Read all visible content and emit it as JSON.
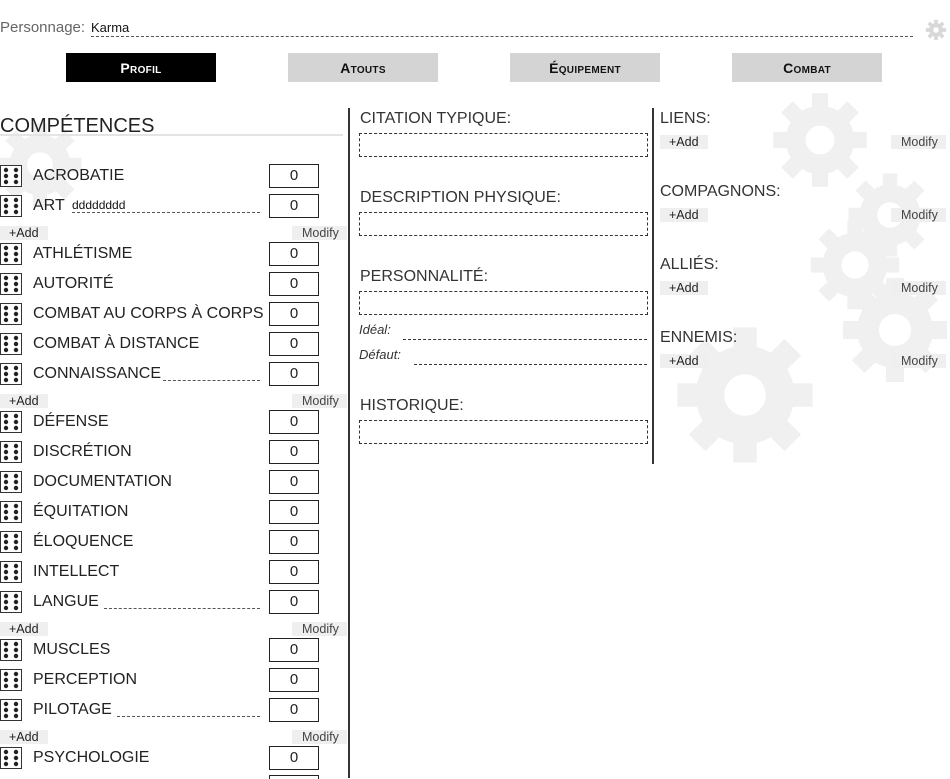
{
  "header": {
    "character_label": "Personnage:",
    "character_name": "Karma"
  },
  "tabs": [
    {
      "label": "Profil",
      "active": true
    },
    {
      "label": "Atouts",
      "active": false
    },
    {
      "label": "Équipement",
      "active": false
    },
    {
      "label": "Combat",
      "active": false
    }
  ],
  "competences": {
    "title": "COMPÉTENCES",
    "add_label": "+Add",
    "modify_label": "Modify",
    "skills": [
      {
        "name": "ACROBATIE",
        "value": "0"
      },
      {
        "name": "ART",
        "specialty": "dddddddd",
        "value": "0"
      },
      {
        "name": "ATHLÉTISME",
        "value": "0"
      },
      {
        "name": "AUTORITÉ",
        "value": "0"
      },
      {
        "name": "COMBAT AU CORPS À CORPS",
        "value": "0"
      },
      {
        "name": "COMBAT À DISTANCE",
        "value": "0"
      },
      {
        "name": "CONNAISSANCE",
        "specialty": "",
        "value": "0"
      },
      {
        "name": "DÉFENSE",
        "value": "0"
      },
      {
        "name": "DISCRÉTION",
        "value": "0"
      },
      {
        "name": "DOCUMENTATION",
        "value": "0"
      },
      {
        "name": "ÉQUITATION",
        "value": "0"
      },
      {
        "name": "ÉLOQUENCE",
        "value": "0"
      },
      {
        "name": "INTELLECT",
        "value": "0"
      },
      {
        "name": "LANGUE",
        "specialty": "",
        "value": "0"
      },
      {
        "name": "MUSCLES",
        "value": "0"
      },
      {
        "name": "PERCEPTION",
        "value": "0"
      },
      {
        "name": "PILOTAGE",
        "specialty": "",
        "value": "0"
      },
      {
        "name": "PSYCHOLOGIE",
        "value": "0"
      }
    ]
  },
  "profile": {
    "citation_label": "CITATION TYPIQUE:",
    "description_label": "DESCRIPTION PHYSIQUE:",
    "personnalite_label": "PERSONNALITÉ:",
    "ideal_label": "Idéal:",
    "defaut_label": "Défaut:",
    "historique_label": "HISTORIQUE:"
  },
  "relations": {
    "add_label": "+Add",
    "modify_label": "Modify",
    "liens_label": "LIENS:",
    "compagnons_label": "COMPAGNONS:",
    "allies_label": "ALLIÉS:",
    "ennemis_label": "ENNEMIS:"
  },
  "colors": {
    "active_tab": "#000000",
    "inactive_tab": "#d4d4d4",
    "button_bg": "#efefef",
    "gear": "#f0f0f0"
  },
  "icons": {
    "settings": "gear-icon",
    "dice": "dice-six-icon",
    "watermark": "gears-watermark"
  }
}
